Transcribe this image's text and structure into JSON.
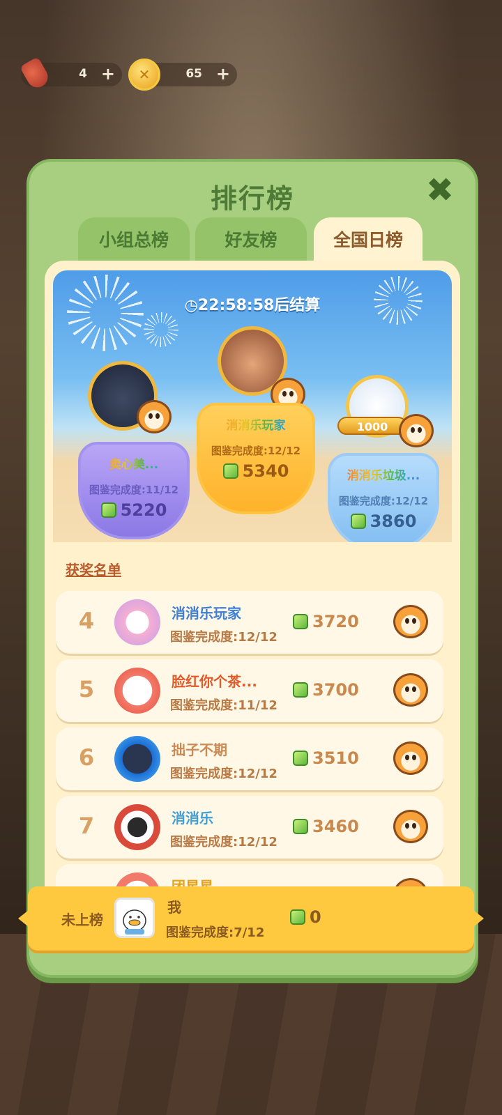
{
  "resources": {
    "item_count": "4",
    "coin_count": "65",
    "plus": "+"
  },
  "panel": {
    "title": "排行榜",
    "close_glyph": "✖"
  },
  "tabs": [
    {
      "label": "小组总榜",
      "active": false
    },
    {
      "label": "好友榜",
      "active": false
    },
    {
      "label": "全国日榜",
      "active": true
    }
  ],
  "countdown": "◷22:58:58后结算",
  "podium": [
    {
      "place": 2,
      "name": "卖心美...",
      "completion": "图鉴完成度:11/12",
      "score": "5220"
    },
    {
      "place": 1,
      "name": "消消乐玩家",
      "completion": "图鉴完成度:12/12",
      "score": "5340"
    },
    {
      "place": 3,
      "name": "消消乐垃圾...",
      "completion": "图鉴完成度:12/12",
      "score": "3860",
      "frame_badge": "1000"
    }
  ],
  "winners_title": "获奖名单",
  "ranking": [
    {
      "rank": "4",
      "name": "消消乐玩家",
      "completion": "图鉴完成度:12/12",
      "score": "3720",
      "name_color": "#3f7fd6"
    },
    {
      "rank": "5",
      "name": "脸红你个茶...",
      "completion": "图鉴完成度:11/12",
      "score": "3700",
      "name_color": "#e05a2a"
    },
    {
      "rank": "6",
      "name": "拙子不期",
      "completion": "图鉴完成度:12/12",
      "score": "3510",
      "name_color": "#c98a55"
    },
    {
      "rank": "7",
      "name": "消消乐",
      "completion": "图鉴完成度:12/12",
      "score": "3460",
      "name_color": "#3f9fd6"
    },
    {
      "rank": "",
      "name": "团星星",
      "completion": "",
      "score": "",
      "name_color": "#e6a21a"
    }
  ],
  "me": {
    "status": "未上榜",
    "name": "我",
    "completion": "图鉴完成度:7/12",
    "score": "0"
  }
}
